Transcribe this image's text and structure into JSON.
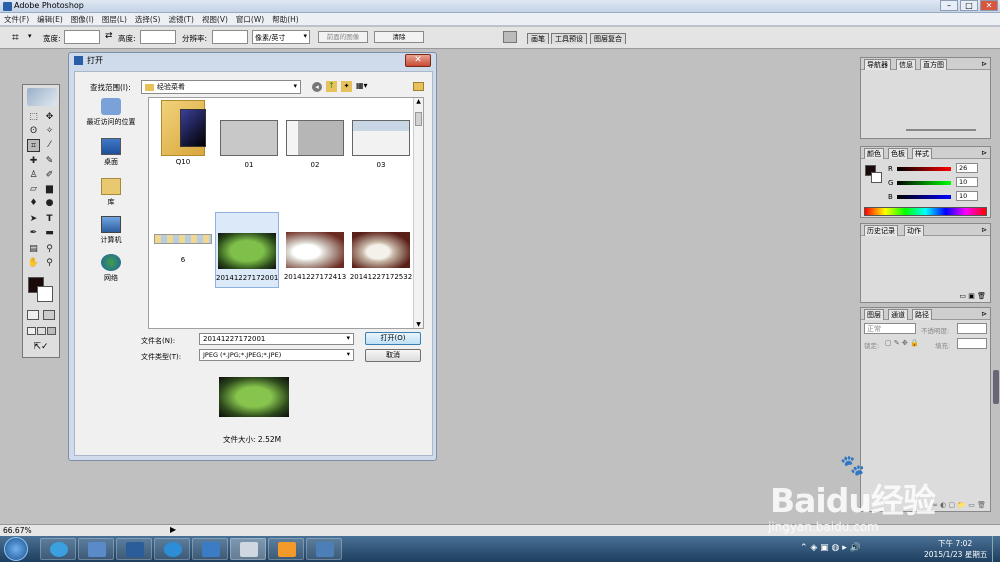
{
  "app_title": "Adobe Photoshop",
  "window_buttons": [
    "–",
    "□",
    "✕"
  ],
  "menus": [
    "文件(F)",
    "编辑(E)",
    "图像(I)",
    "图层(L)",
    "选择(S)",
    "滤镜(T)",
    "视图(V)",
    "窗口(W)",
    "帮助(H)"
  ],
  "options": {
    "width_label": "宽度:",
    "height_label": "高度:",
    "resolution_label": "分辨率:",
    "unit": "像素/英寸",
    "front_image_button": "前面的图像",
    "clear_button": "清除"
  },
  "workspace_tabs": [
    "画笔",
    "工具预设",
    "图层复合"
  ],
  "panels": {
    "navigator_tabs": [
      "导航器",
      "信息",
      "直方图"
    ],
    "color_tabs": [
      "颜色",
      "色板",
      "样式"
    ],
    "color": {
      "r_label": "R",
      "g_label": "G",
      "b_label": "B",
      "r": "26",
      "g": "10",
      "b": "10"
    },
    "history_tabs": [
      "历史记录",
      "动作"
    ],
    "layers_tabs": [
      "图层",
      "通道",
      "路径"
    ],
    "layers": {
      "blend_mode": "正常",
      "opacity_label": "不透明度:",
      "lock_label": "锁定:",
      "fill_label": "填充:"
    }
  },
  "colors": {
    "foreground": "#1a0a0a",
    "background": "#ffffff"
  },
  "dialog": {
    "title": "打开",
    "close": "✕",
    "look_in_label": "查找范围(I):",
    "look_in_value": "经验菜肴",
    "places": [
      {
        "label": "最近访问的位置",
        "icon": "recent-places-icon"
      },
      {
        "label": "桌面",
        "icon": "desktop-icon"
      },
      {
        "label": "库",
        "icon": "libraries-icon"
      },
      {
        "label": "计算机",
        "icon": "computer-icon"
      },
      {
        "label": "网络",
        "icon": "network-icon"
      }
    ],
    "files": [
      {
        "name": "Q10",
        "kind": "folder"
      },
      {
        "name": "01",
        "kind": "screenshot"
      },
      {
        "name": "02",
        "kind": "screenshot"
      },
      {
        "name": "03",
        "kind": "screenshot"
      },
      {
        "name": "6",
        "kind": "strip"
      },
      {
        "name": "20141227172001",
        "kind": "photo-green",
        "selected": true
      },
      {
        "name": "20141227172413",
        "kind": "photo-white"
      },
      {
        "name": "20141227172532",
        "kind": "photo-white-red"
      }
    ],
    "filename_label": "文件名(N):",
    "filename_value": "20141227172001",
    "filetype_label": "文件类型(T):",
    "filetype_value": "JPEG (*.JPG;*.JPEG;*.JPE)",
    "open_button": "打开(O)",
    "cancel_button": "取消",
    "filesize_label": "文件大小: 2.52M"
  },
  "status": {
    "zoom": "66.67%"
  },
  "taskbar": {
    "time": "下午 7:02",
    "date": "2015/1/23 星期五"
  },
  "watermark": {
    "text": "Baidu经验",
    "url": "jingyan.baidu.com"
  }
}
